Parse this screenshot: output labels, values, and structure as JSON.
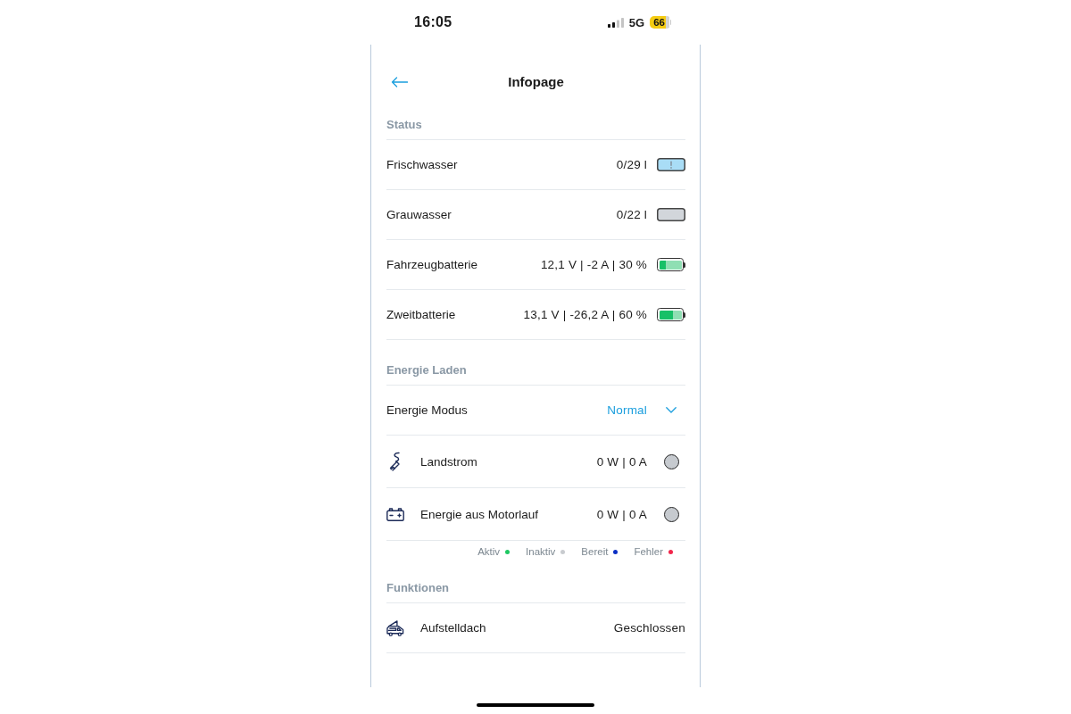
{
  "status_bar": {
    "time": "16:05",
    "network": "5G",
    "battery": "66"
  },
  "header": {
    "title": "Infopage"
  },
  "sections": [
    {
      "title": "Status",
      "rows": [
        {
          "kind": "tank",
          "label": "Frischwasser",
          "value": "0/29 l",
          "color": "#a9ddf6",
          "warning": true
        },
        {
          "kind": "tank",
          "label": "Grauwasser",
          "value": "0/22 l",
          "color": "#d2d6db",
          "warning": false
        },
        {
          "kind": "battery",
          "label": "Fahrzeugbatterie",
          "value": "12,1 V | -2 A | 30 %",
          "level": 0.3
        },
        {
          "kind": "battery",
          "label": "Zweitbatterie",
          "value": "13,1 V | -26,2 A | 60 %",
          "level": 0.6
        }
      ]
    },
    {
      "title": "Energie Laden",
      "rows": [
        {
          "kind": "select",
          "label": "Energie Modus",
          "value": "Normal"
        },
        {
          "kind": "plug",
          "label": "Landstrom",
          "value": "0 W | 0 A",
          "color": "#c6cacf"
        },
        {
          "kind": "engine",
          "label": "Energie aus Motorlauf",
          "value": "0 W | 0 A",
          "color": "#c6cacf"
        }
      ],
      "legend": [
        {
          "label": "Aktiv",
          "color": "#1fc862"
        },
        {
          "label": "Inaktiv",
          "color": "#c8cbcf"
        },
        {
          "label": "Bereit",
          "color": "#0b2fc4"
        },
        {
          "label": "Fehler",
          "color": "#f2264b"
        }
      ]
    },
    {
      "title": "Funktionen",
      "rows": [
        {
          "kind": "roof",
          "label": "Aufstelldach",
          "value": "Geschlossen"
        }
      ]
    }
  ]
}
